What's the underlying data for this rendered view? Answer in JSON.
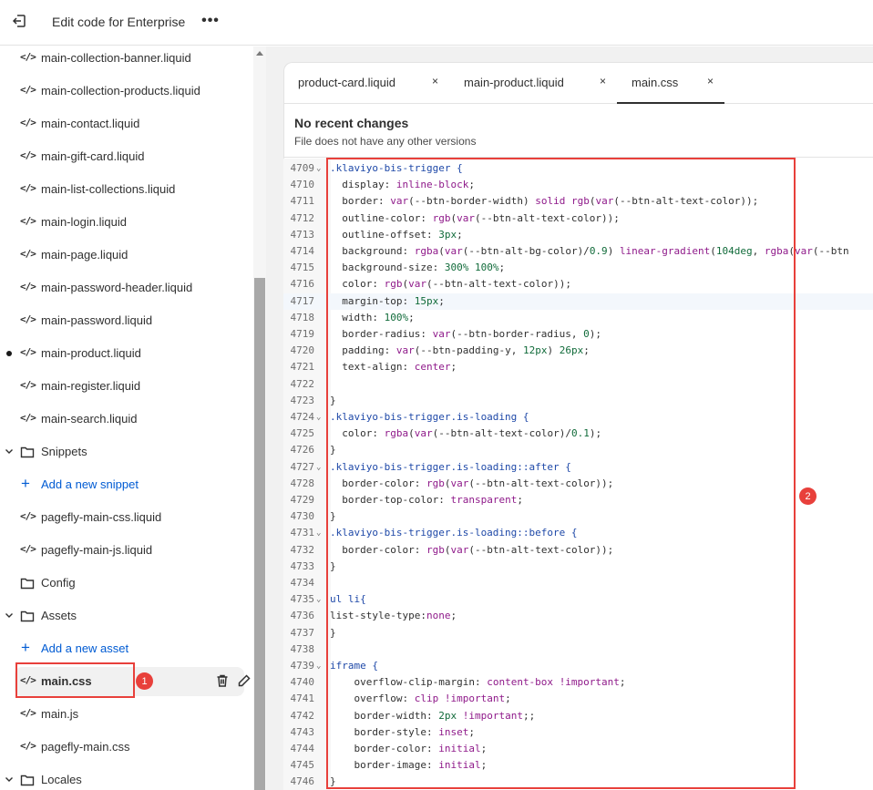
{
  "topbar": {
    "title": "Edit code for Enterprise",
    "more_label": "•••"
  },
  "sidebar": {
    "files_top": [
      "main-collection-banner.liquid",
      "main-collection-products.liquid",
      "main-contact.liquid",
      "main-gift-card.liquid",
      "main-list-collections.liquid",
      "main-login.liquid",
      "main-page.liquid",
      "main-password-header.liquid",
      "main-password.liquid",
      "main-product.liquid",
      "main-register.liquid",
      "main-search.liquid"
    ],
    "code_glyph": "</>",
    "snippets_label": "Snippets",
    "add_snippet_label": "Add a new snippet",
    "snippets": [
      "pagefly-main-css.liquid",
      "pagefly-main-js.liquid"
    ],
    "config_label": "Config",
    "assets_label": "Assets",
    "add_asset_label": "Add a new asset",
    "assets": [
      "main.css",
      "main.js",
      "pagefly-main.css"
    ],
    "locales_label": "Locales",
    "badge1": "1"
  },
  "tabs": [
    {
      "label": "product-card.liquid",
      "close": "×"
    },
    {
      "label": "main-product.liquid",
      "close": "×"
    },
    {
      "label": "main.css",
      "close": "×"
    }
  ],
  "changes": {
    "title": "No recent changes",
    "subtitle": "File does not have any other versions"
  },
  "badge2": "2",
  "code": [
    {
      "n": "4709",
      "fold": "⌄",
      "t": ".klaviyo-bis-trigger {"
    },
    {
      "n": "4710",
      "t": "  display: inline-block;"
    },
    {
      "n": "4711",
      "t": "  border: var(--btn-border-width) solid rgb(var(--btn-alt-text-color));"
    },
    {
      "n": "4712",
      "t": "  outline-color: rgb(var(--btn-alt-text-color));"
    },
    {
      "n": "4713",
      "t": "  outline-offset: 3px;"
    },
    {
      "n": "4714",
      "t": "  background: rgba(var(--btn-alt-bg-color)/0.9) linear-gradient(104deg, rgba(var(--btn"
    },
    {
      "n": "4715",
      "t": "  background-size: 300% 100%;"
    },
    {
      "n": "4716",
      "t": "  color: rgb(var(--btn-alt-text-color));"
    },
    {
      "n": "4717",
      "t": "  margin-top: 15px;"
    },
    {
      "n": "4718",
      "t": "  width: 100%;"
    },
    {
      "n": "4719",
      "t": "  border-radius: var(--btn-border-radius, 0);"
    },
    {
      "n": "4720",
      "t": "  padding: var(--btn-padding-y, 12px) 26px;"
    },
    {
      "n": "4721",
      "t": "  text-align: center;"
    },
    {
      "n": "4722",
      "t": ""
    },
    {
      "n": "4723",
      "t": "}"
    },
    {
      "n": "4724",
      "fold": "⌄",
      "t": ".klaviyo-bis-trigger.is-loading {"
    },
    {
      "n": "4725",
      "t": "  color: rgba(var(--btn-alt-text-color)/0.1);"
    },
    {
      "n": "4726",
      "t": "}"
    },
    {
      "n": "4727",
      "fold": "⌄",
      "t": ".klaviyo-bis-trigger.is-loading::after {"
    },
    {
      "n": "4728",
      "t": "  border-color: rgb(var(--btn-alt-text-color));"
    },
    {
      "n": "4729",
      "t": "  border-top-color: transparent;"
    },
    {
      "n": "4730",
      "t": "}"
    },
    {
      "n": "4731",
      "fold": "⌄",
      "t": ".klaviyo-bis-trigger.is-loading::before {"
    },
    {
      "n": "4732",
      "t": "  border-color: rgb(var(--btn-alt-text-color));"
    },
    {
      "n": "4733",
      "t": "}"
    },
    {
      "n": "4734",
      "t": ""
    },
    {
      "n": "4735",
      "fold": "⌄",
      "t": "ul li{"
    },
    {
      "n": "4736",
      "t": "list-style-type:none;"
    },
    {
      "n": "4737",
      "t": "}"
    },
    {
      "n": "4738",
      "t": ""
    },
    {
      "n": "4739",
      "fold": "⌄",
      "t": "iframe {"
    },
    {
      "n": "4740",
      "t": "    overflow-clip-margin: content-box !important;"
    },
    {
      "n": "4741",
      "t": "    overflow: clip !important;"
    },
    {
      "n": "4742",
      "t": "    border-width: 2px !important;;"
    },
    {
      "n": "4743",
      "t": "    border-style: inset;"
    },
    {
      "n": "4744",
      "t": "    border-color: initial;"
    },
    {
      "n": "4745",
      "t": "    border-image: initial;"
    },
    {
      "n": "4746",
      "t": "}"
    }
  ],
  "colors": {
    "highlight_red": "#e8403b",
    "link_blue": "#005bd3",
    "selector_blue": "#1f49a8",
    "value_purple": "#8f1a8a"
  }
}
